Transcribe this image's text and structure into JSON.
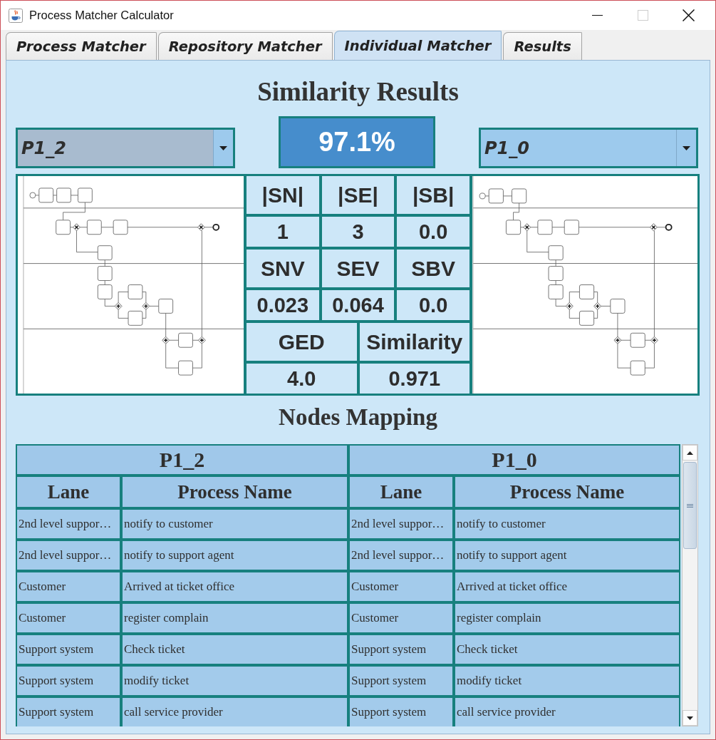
{
  "window": {
    "title": "Process Matcher Calculator",
    "maximize_disabled": true
  },
  "tabs": [
    {
      "label": "Process Matcher",
      "selected": false
    },
    {
      "label": "Repository Matcher",
      "selected": false
    },
    {
      "label": "Individual Matcher",
      "selected": true
    },
    {
      "label": "Results",
      "selected": false
    }
  ],
  "similarity_results": {
    "title": "Similarity Results",
    "selectors": [
      {
        "value": "P1_2",
        "focused": true
      },
      {
        "value": "P1_0",
        "focused": false
      }
    ],
    "score": "97.1%",
    "metric_groups": [
      [
        {
          "label": "|SN|",
          "value": "1"
        },
        {
          "label": "|SE|",
          "value": "3"
        },
        {
          "label": "|SB|",
          "value": "0.0"
        }
      ],
      [
        {
          "label": "SNV",
          "value": "0.023"
        },
        {
          "label": "SEV",
          "value": "0.064"
        },
        {
          "label": "SBV",
          "value": "0.0"
        }
      ],
      [
        {
          "label": "GED",
          "value": "4.0"
        },
        {
          "label": "Similarity",
          "value": "0.971"
        }
      ]
    ]
  },
  "nodes_mapping": {
    "title": "Nodes Mapping",
    "processes": [
      "P1_2",
      "P1_0"
    ],
    "columns": [
      "Lane",
      "Process Name",
      "Lane",
      "Process Name"
    ],
    "rows": [
      [
        "2nd level suppor…",
        "notify to customer",
        "2nd level suppor…",
        "notify to customer"
      ],
      [
        "2nd level suppor…",
        "notify to support agent",
        "2nd level suppor…",
        "notify to support agent"
      ],
      [
        "Customer",
        "Arrived at ticket office",
        "Customer",
        "Arrived at ticket office"
      ],
      [
        "Customer",
        "register complain",
        "Customer",
        "register complain"
      ],
      [
        "Support system",
        "Check ticket",
        "Support system",
        "Check ticket"
      ],
      [
        "Support system",
        "modify ticket",
        "Support system",
        "modify ticket"
      ],
      [
        "Support system",
        "call service provider",
        "Support system",
        "call service provider"
      ]
    ]
  }
}
